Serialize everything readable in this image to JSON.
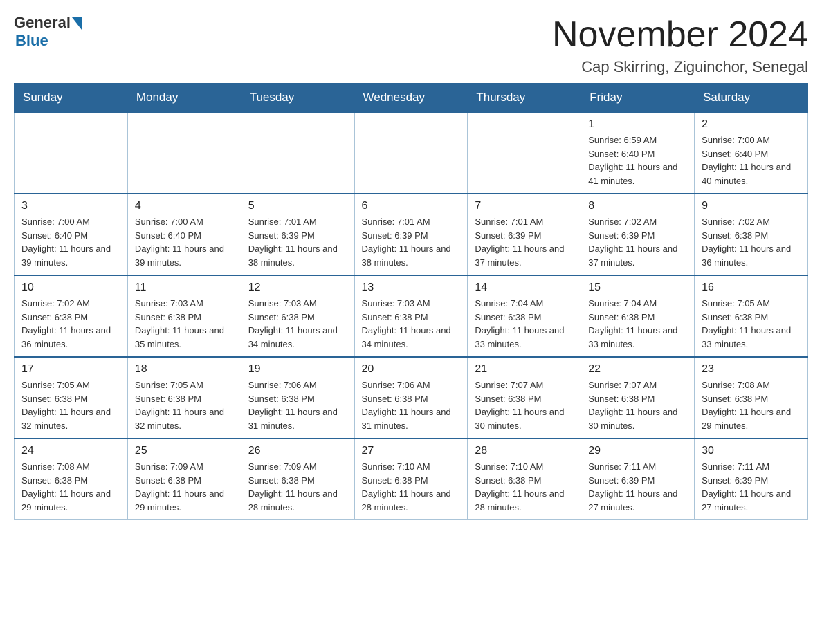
{
  "header": {
    "logo_general": "General",
    "logo_blue": "Blue",
    "main_title": "November 2024",
    "subtitle": "Cap Skirring, Ziguinchor, Senegal"
  },
  "days_of_week": [
    "Sunday",
    "Monday",
    "Tuesday",
    "Wednesday",
    "Thursday",
    "Friday",
    "Saturday"
  ],
  "weeks": [
    [
      {
        "day": "",
        "sunrise": "",
        "sunset": "",
        "daylight": ""
      },
      {
        "day": "",
        "sunrise": "",
        "sunset": "",
        "daylight": ""
      },
      {
        "day": "",
        "sunrise": "",
        "sunset": "",
        "daylight": ""
      },
      {
        "day": "",
        "sunrise": "",
        "sunset": "",
        "daylight": ""
      },
      {
        "day": "",
        "sunrise": "",
        "sunset": "",
        "daylight": ""
      },
      {
        "day": "1",
        "sunrise": "Sunrise: 6:59 AM",
        "sunset": "Sunset: 6:40 PM",
        "daylight": "Daylight: 11 hours and 41 minutes."
      },
      {
        "day": "2",
        "sunrise": "Sunrise: 7:00 AM",
        "sunset": "Sunset: 6:40 PM",
        "daylight": "Daylight: 11 hours and 40 minutes."
      }
    ],
    [
      {
        "day": "3",
        "sunrise": "Sunrise: 7:00 AM",
        "sunset": "Sunset: 6:40 PM",
        "daylight": "Daylight: 11 hours and 39 minutes."
      },
      {
        "day": "4",
        "sunrise": "Sunrise: 7:00 AM",
        "sunset": "Sunset: 6:40 PM",
        "daylight": "Daylight: 11 hours and 39 minutes."
      },
      {
        "day": "5",
        "sunrise": "Sunrise: 7:01 AM",
        "sunset": "Sunset: 6:39 PM",
        "daylight": "Daylight: 11 hours and 38 minutes."
      },
      {
        "day": "6",
        "sunrise": "Sunrise: 7:01 AM",
        "sunset": "Sunset: 6:39 PM",
        "daylight": "Daylight: 11 hours and 38 minutes."
      },
      {
        "day": "7",
        "sunrise": "Sunrise: 7:01 AM",
        "sunset": "Sunset: 6:39 PM",
        "daylight": "Daylight: 11 hours and 37 minutes."
      },
      {
        "day": "8",
        "sunrise": "Sunrise: 7:02 AM",
        "sunset": "Sunset: 6:39 PM",
        "daylight": "Daylight: 11 hours and 37 minutes."
      },
      {
        "day": "9",
        "sunrise": "Sunrise: 7:02 AM",
        "sunset": "Sunset: 6:38 PM",
        "daylight": "Daylight: 11 hours and 36 minutes."
      }
    ],
    [
      {
        "day": "10",
        "sunrise": "Sunrise: 7:02 AM",
        "sunset": "Sunset: 6:38 PM",
        "daylight": "Daylight: 11 hours and 36 minutes."
      },
      {
        "day": "11",
        "sunrise": "Sunrise: 7:03 AM",
        "sunset": "Sunset: 6:38 PM",
        "daylight": "Daylight: 11 hours and 35 minutes."
      },
      {
        "day": "12",
        "sunrise": "Sunrise: 7:03 AM",
        "sunset": "Sunset: 6:38 PM",
        "daylight": "Daylight: 11 hours and 34 minutes."
      },
      {
        "day": "13",
        "sunrise": "Sunrise: 7:03 AM",
        "sunset": "Sunset: 6:38 PM",
        "daylight": "Daylight: 11 hours and 34 minutes."
      },
      {
        "day": "14",
        "sunrise": "Sunrise: 7:04 AM",
        "sunset": "Sunset: 6:38 PM",
        "daylight": "Daylight: 11 hours and 33 minutes."
      },
      {
        "day": "15",
        "sunrise": "Sunrise: 7:04 AM",
        "sunset": "Sunset: 6:38 PM",
        "daylight": "Daylight: 11 hours and 33 minutes."
      },
      {
        "day": "16",
        "sunrise": "Sunrise: 7:05 AM",
        "sunset": "Sunset: 6:38 PM",
        "daylight": "Daylight: 11 hours and 33 minutes."
      }
    ],
    [
      {
        "day": "17",
        "sunrise": "Sunrise: 7:05 AM",
        "sunset": "Sunset: 6:38 PM",
        "daylight": "Daylight: 11 hours and 32 minutes."
      },
      {
        "day": "18",
        "sunrise": "Sunrise: 7:05 AM",
        "sunset": "Sunset: 6:38 PM",
        "daylight": "Daylight: 11 hours and 32 minutes."
      },
      {
        "day": "19",
        "sunrise": "Sunrise: 7:06 AM",
        "sunset": "Sunset: 6:38 PM",
        "daylight": "Daylight: 11 hours and 31 minutes."
      },
      {
        "day": "20",
        "sunrise": "Sunrise: 7:06 AM",
        "sunset": "Sunset: 6:38 PM",
        "daylight": "Daylight: 11 hours and 31 minutes."
      },
      {
        "day": "21",
        "sunrise": "Sunrise: 7:07 AM",
        "sunset": "Sunset: 6:38 PM",
        "daylight": "Daylight: 11 hours and 30 minutes."
      },
      {
        "day": "22",
        "sunrise": "Sunrise: 7:07 AM",
        "sunset": "Sunset: 6:38 PM",
        "daylight": "Daylight: 11 hours and 30 minutes."
      },
      {
        "day": "23",
        "sunrise": "Sunrise: 7:08 AM",
        "sunset": "Sunset: 6:38 PM",
        "daylight": "Daylight: 11 hours and 29 minutes."
      }
    ],
    [
      {
        "day": "24",
        "sunrise": "Sunrise: 7:08 AM",
        "sunset": "Sunset: 6:38 PM",
        "daylight": "Daylight: 11 hours and 29 minutes."
      },
      {
        "day": "25",
        "sunrise": "Sunrise: 7:09 AM",
        "sunset": "Sunset: 6:38 PM",
        "daylight": "Daylight: 11 hours and 29 minutes."
      },
      {
        "day": "26",
        "sunrise": "Sunrise: 7:09 AM",
        "sunset": "Sunset: 6:38 PM",
        "daylight": "Daylight: 11 hours and 28 minutes."
      },
      {
        "day": "27",
        "sunrise": "Sunrise: 7:10 AM",
        "sunset": "Sunset: 6:38 PM",
        "daylight": "Daylight: 11 hours and 28 minutes."
      },
      {
        "day": "28",
        "sunrise": "Sunrise: 7:10 AM",
        "sunset": "Sunset: 6:38 PM",
        "daylight": "Daylight: 11 hours and 28 minutes."
      },
      {
        "day": "29",
        "sunrise": "Sunrise: 7:11 AM",
        "sunset": "Sunset: 6:39 PM",
        "daylight": "Daylight: 11 hours and 27 minutes."
      },
      {
        "day": "30",
        "sunrise": "Sunrise: 7:11 AM",
        "sunset": "Sunset: 6:39 PM",
        "daylight": "Daylight: 11 hours and 27 minutes."
      }
    ]
  ]
}
